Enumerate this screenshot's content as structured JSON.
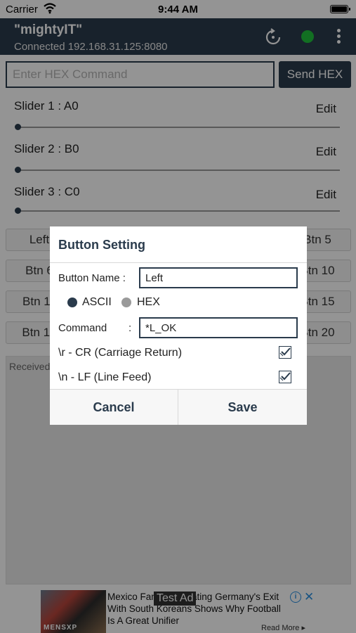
{
  "status_bar": {
    "carrier": "Carrier",
    "time": "9:44 AM"
  },
  "app_bar": {
    "title": "\"mightyIT\"",
    "subtitle": "Connected 192.168.31.125:8080",
    "status_color": "#1fbf3c"
  },
  "hex": {
    "placeholder": "Enter HEX Command",
    "send_label": "Send HEX"
  },
  "sliders": [
    {
      "label": "Slider 1 : A0",
      "edit": "Edit"
    },
    {
      "label": "Slider 2 : B0",
      "edit": "Edit"
    },
    {
      "label": "Slider 3 : C0",
      "edit": "Edit"
    }
  ],
  "buttons": {
    "row1": {
      "left": "Left",
      "right": "Btn 5"
    },
    "row2": {
      "left": "Btn 6",
      "right": "Btn 10"
    },
    "row3": {
      "left": "Btn 11",
      "right": "Btn 15"
    },
    "row4": {
      "left": "Btn 16",
      "right": "Btn 20"
    }
  },
  "receive": {
    "label": "Received"
  },
  "ad": {
    "headline": "Mexico Fans Celebrating Germany's Exit With South Koreans Shows Why Football Is A Great Unifier",
    "chip": "Test Ad",
    "brand": "MENSXP",
    "read_more": "Read More ▸"
  },
  "dialog": {
    "title": "Button Setting",
    "name_label": "Button Name :",
    "name_value": "Left",
    "radio_ascii": "ASCII",
    "radio_hex": "HEX",
    "command_label": "Command",
    "command_colon": ":",
    "command_value": "*L_OK",
    "cr_label": "\\r - CR (Carriage Return)",
    "lf_label": "\\n - LF (Line Feed)",
    "cancel": "Cancel",
    "save": "Save"
  },
  "colors": {
    "primary": "#2a3b4c",
    "accent_green": "#1fbf3c"
  }
}
